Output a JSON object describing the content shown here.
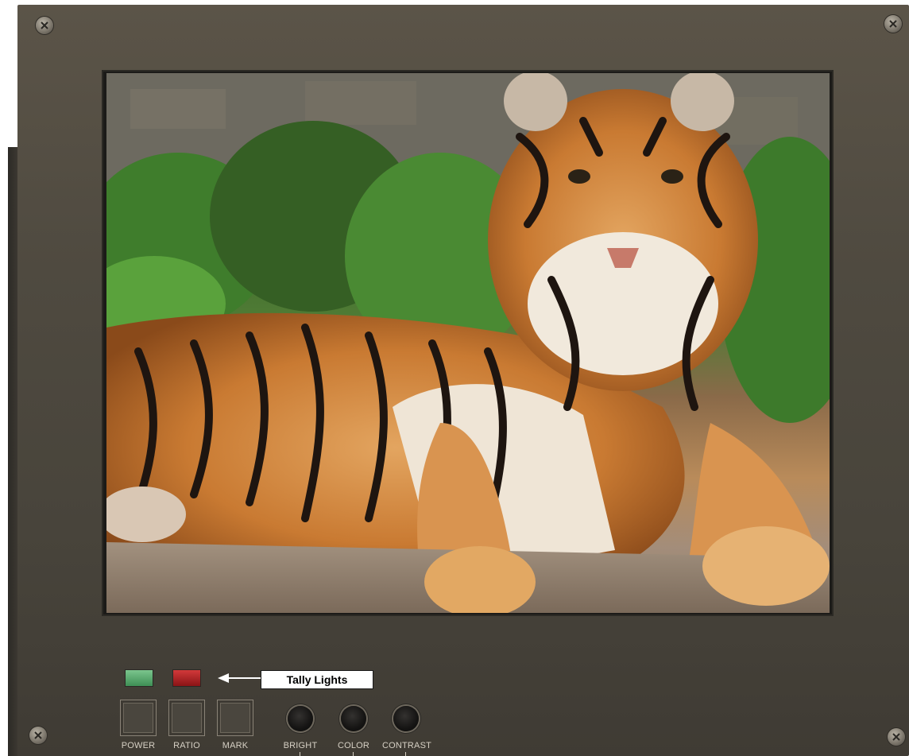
{
  "panel": {
    "tally_label": "Tally Lights",
    "leds": [
      {
        "name": "power-led",
        "color": "#5cb274"
      },
      {
        "name": "ratio-led",
        "color": "#c0262a"
      }
    ],
    "buttons": [
      {
        "id": "power",
        "label": "POWER"
      },
      {
        "id": "ratio",
        "label": "RATIO"
      },
      {
        "id": "mark",
        "label": "MARK"
      }
    ],
    "knobs": [
      {
        "id": "bright",
        "label": "BRIGHT"
      },
      {
        "id": "color",
        "label": "COLOR"
      },
      {
        "id": "contrast",
        "label": "CONTRAST"
      }
    ]
  },
  "screen": {
    "content": "tiger-photo"
  }
}
